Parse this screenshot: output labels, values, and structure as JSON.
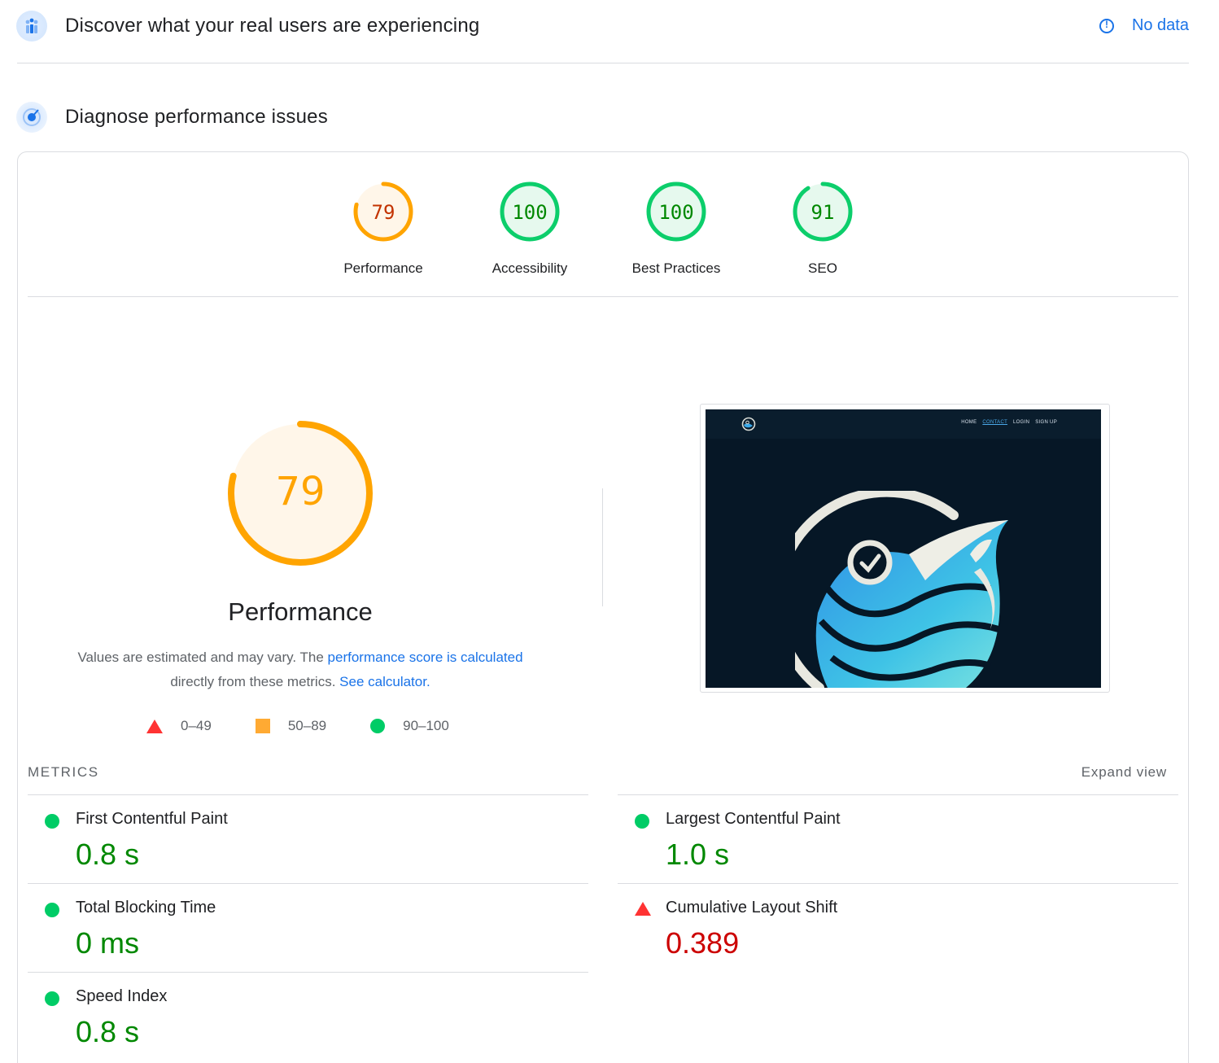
{
  "crux": {
    "title": "Discover what your real users are experiencing",
    "no_data": "No data"
  },
  "diagnose": {
    "title": "Diagnose performance issues"
  },
  "colors": {
    "pass": "#0cce6b",
    "average": "#ffa400",
    "fail": "#ff4e42",
    "pass_text": "#008800",
    "average_text": "#c33300",
    "fail_text": "#cc0000",
    "link": "#1a73e8"
  },
  "scores": [
    {
      "label": "Performance",
      "value": "79",
      "score": 0.79,
      "rating": "average"
    },
    {
      "label": "Accessibility",
      "value": "100",
      "score": 1.0,
      "rating": "pass"
    },
    {
      "label": "Best Practices",
      "value": "100",
      "score": 1.0,
      "rating": "pass"
    },
    {
      "label": "SEO",
      "value": "91",
      "score": 0.91,
      "rating": "pass"
    }
  ],
  "performance": {
    "score": "79",
    "score_fraction": 0.79,
    "title": "Performance",
    "desc_text_1": "Values are estimated and may vary. The ",
    "desc_link_1": "performance score is calculated",
    "desc_text_2": " directly from these metrics. ",
    "desc_link_2": "See calculator.",
    "legend": [
      {
        "shape": "triangle",
        "range": "0–49"
      },
      {
        "shape": "square",
        "range": "50–89"
      },
      {
        "shape": "circle",
        "range": "90–100"
      }
    ]
  },
  "screenshot": {
    "nav_links": [
      "HOME",
      "CONTACT",
      "LOGIN",
      "SIGN UP"
    ]
  },
  "metrics": {
    "title": "METRICS",
    "expand_label": "Expand view",
    "items": [
      {
        "label": "First Contentful Paint",
        "value": "0.8 s",
        "rating": "pass"
      },
      {
        "label": "Largest Contentful Paint",
        "value": "1.0 s",
        "rating": "pass"
      },
      {
        "label": "Total Blocking Time",
        "value": "0 ms",
        "rating": "pass"
      },
      {
        "label": "Cumulative Layout Shift",
        "value": "0.389",
        "rating": "fail"
      },
      {
        "label": "Speed Index",
        "value": "0.8 s",
        "rating": "pass"
      }
    ]
  }
}
